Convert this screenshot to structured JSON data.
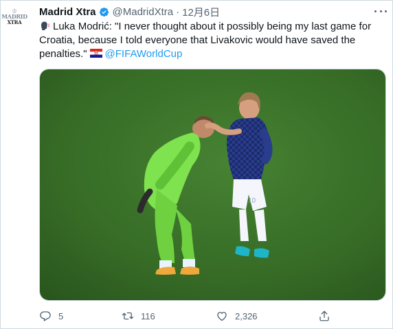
{
  "tweet": {
    "author": {
      "name": "Madrid Xtra",
      "handle": "@MadridXtra",
      "avatar_text_line1": "MADRID",
      "avatar_text_line2": "XTRA"
    },
    "separator": "·",
    "timestamp": "12月6日",
    "text_main": "Luka Modrić: \"I never thought about it possibly being my last game for Croatia, because I told everyone that Livakovic would have saved the penalties.\"",
    "mention": "@FIFAWorldCup",
    "icons": {
      "lead": "speaking-head-emoji",
      "flag": "croatia-flag-emoji",
      "verified": "verified-badge-icon",
      "more": "more-options-icon"
    },
    "media": {
      "description_icon": "photo",
      "jersey_number": "10"
    },
    "stats": {
      "replies": "5",
      "retweets": "116",
      "likes": "2,326"
    }
  },
  "colors": {
    "accent": "#1d9bf0",
    "text": "#0f1419",
    "muted": "#536471",
    "border": "#cfd9de",
    "pitch": "#3f7a2d"
  }
}
